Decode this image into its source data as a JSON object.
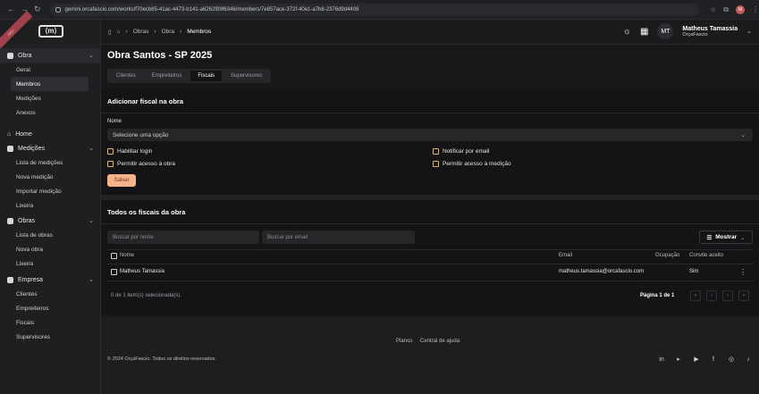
{
  "browser": {
    "url": "gemini.orcafascio.com/works/f70ecb85-41ac-4473-b141-a6262f89f6346/members/7e857ace-372f-40e1-a7b8-2376d9d4406"
  },
  "sidebar": {
    "ribbon": "DEV",
    "logo": "⟨m⟩",
    "sections": [
      {
        "label": "Obra",
        "items": [
          "Geral",
          "Membros",
          "Medições",
          "Anexos"
        ]
      },
      {
        "label": "Home"
      },
      {
        "label": "Medições",
        "items": [
          "Lista de medições",
          "Nova medição",
          "Importar medição",
          "Lixeira"
        ]
      },
      {
        "label": "Obras",
        "items": [
          "Lista de obras",
          "Nova obra",
          "Lixeira"
        ]
      },
      {
        "label": "Empresa",
        "items": [
          "Clientes",
          "Empreiteiros",
          "Fiscais",
          "Supervisores"
        ]
      }
    ]
  },
  "header": {
    "breadcrumb": [
      "Obras",
      "Obra",
      "Membros"
    ],
    "user_initials": "MT",
    "user_name": "Matheus Tamassia",
    "user_org": "OrçaFascio"
  },
  "page": {
    "title": "Obra Santos - SP 2025",
    "tabs": [
      "Clientes",
      "Empreiteiros",
      "Fiscais",
      "Supervisores"
    ]
  },
  "add_form": {
    "title": "Adicionar fiscal na obra",
    "name_label": "Nome",
    "select_placeholder": "Selecione uma opção",
    "checks": {
      "enable_login": "Habilitar login",
      "notify_email": "Notificar por email",
      "allow_obra": "Permitir acesso à obra",
      "allow_medicao": "Permitir acesso à medição"
    },
    "save_label": "Salvar"
  },
  "list": {
    "title": "Todos os fiscais da obra",
    "search_name_placeholder": "Buscar por nome",
    "search_email_placeholder": "Buscar por email",
    "show_button": "Mostrar",
    "columns": [
      "Nome",
      "Email",
      "Ocupação",
      "Convite aceito"
    ],
    "rows": [
      {
        "name": "Matheus Tamassia",
        "email": "matheus.tamassia@orcafascio.com",
        "occupation": "",
        "accepted": "Sim"
      }
    ],
    "selected_text": "0 de 1 item(s) selecionada(s).",
    "pagination": "Página 1 de 1"
  },
  "footer": {
    "links": [
      "Planos",
      "Central de ajuda"
    ],
    "copyright": "© 2024 OrçaFascio. Todos os direitos reservados."
  },
  "colors": {
    "accent": "#f4b38a",
    "checkbox_border": "#d9b780",
    "background": "#141416"
  }
}
